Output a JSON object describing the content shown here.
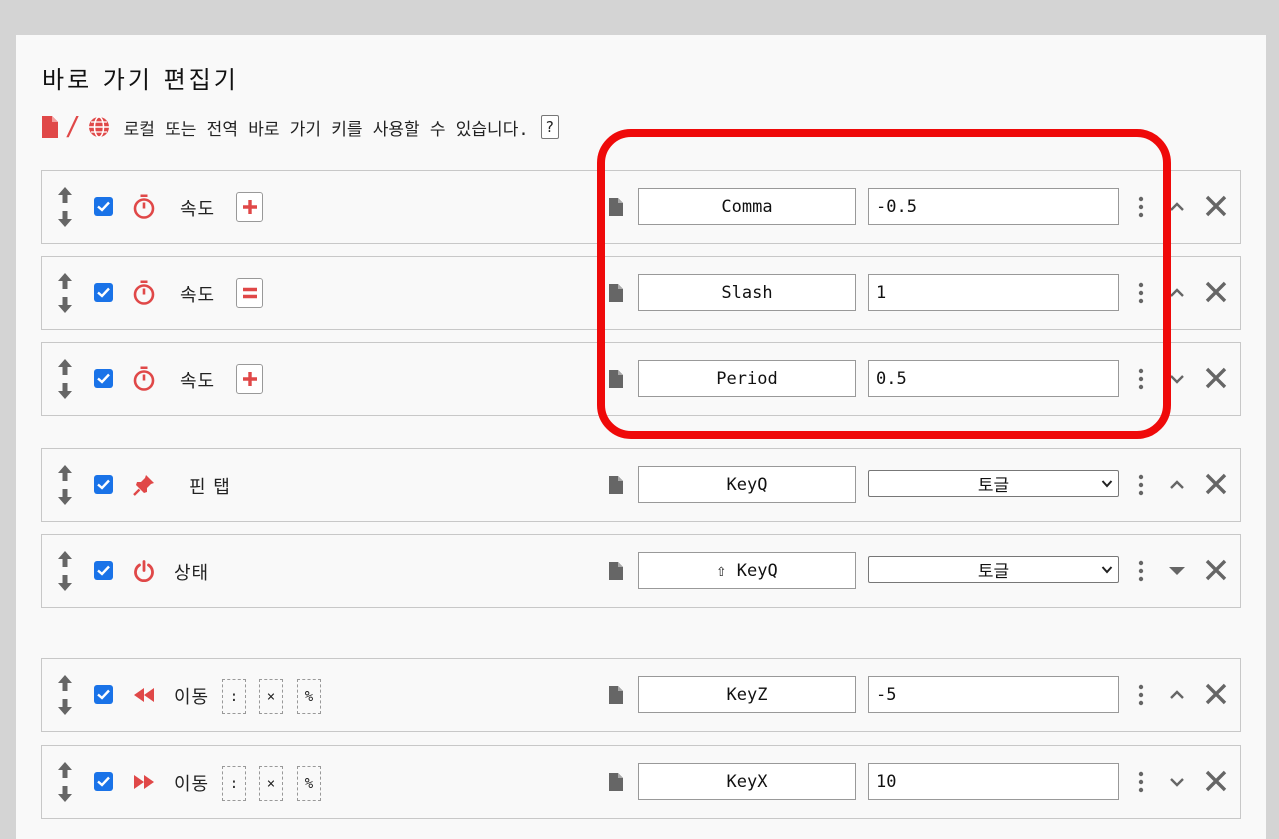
{
  "header": {
    "title": "바로 가기 편집기",
    "subtitle": "로컬 또는 전역 바로 가기 키를 사용할 수 있습니다.",
    "help_label": "?"
  },
  "colors": {
    "accent": "#e04848",
    "checkbox": "#1a73e8",
    "highlight": "#ef0a0a"
  },
  "rows": [
    {
      "label": "속도",
      "icon": "stopwatch-icon",
      "op": "+",
      "key": "Comma",
      "value": "-0.5",
      "chevron": "up"
    },
    {
      "label": "속도",
      "icon": "stopwatch-icon",
      "op": "=",
      "key": "Slash",
      "value": "1",
      "chevron": "up"
    },
    {
      "label": "속도",
      "icon": "stopwatch-icon",
      "op": "+",
      "key": "Period",
      "value": "0.5",
      "chevron": "down"
    },
    {
      "label": "핀 탭",
      "icon": "pin-icon",
      "key": "KeyQ",
      "select": "토글",
      "chevron": "up"
    },
    {
      "label": "상태",
      "icon": "power-icon",
      "key": "⇧ KeyQ",
      "select": "토글",
      "chevron": "caret-down"
    },
    {
      "label": "이동",
      "icon": "rewind-icon",
      "modes": [
        ":",
        "×",
        "%"
      ],
      "key": "KeyZ",
      "value": "-5",
      "chevron": "up"
    },
    {
      "label": "이동",
      "icon": "fast-forward-icon",
      "modes": [
        ":",
        "×",
        "%"
      ],
      "key": "KeyX",
      "value": "10",
      "chevron": "down"
    }
  ]
}
